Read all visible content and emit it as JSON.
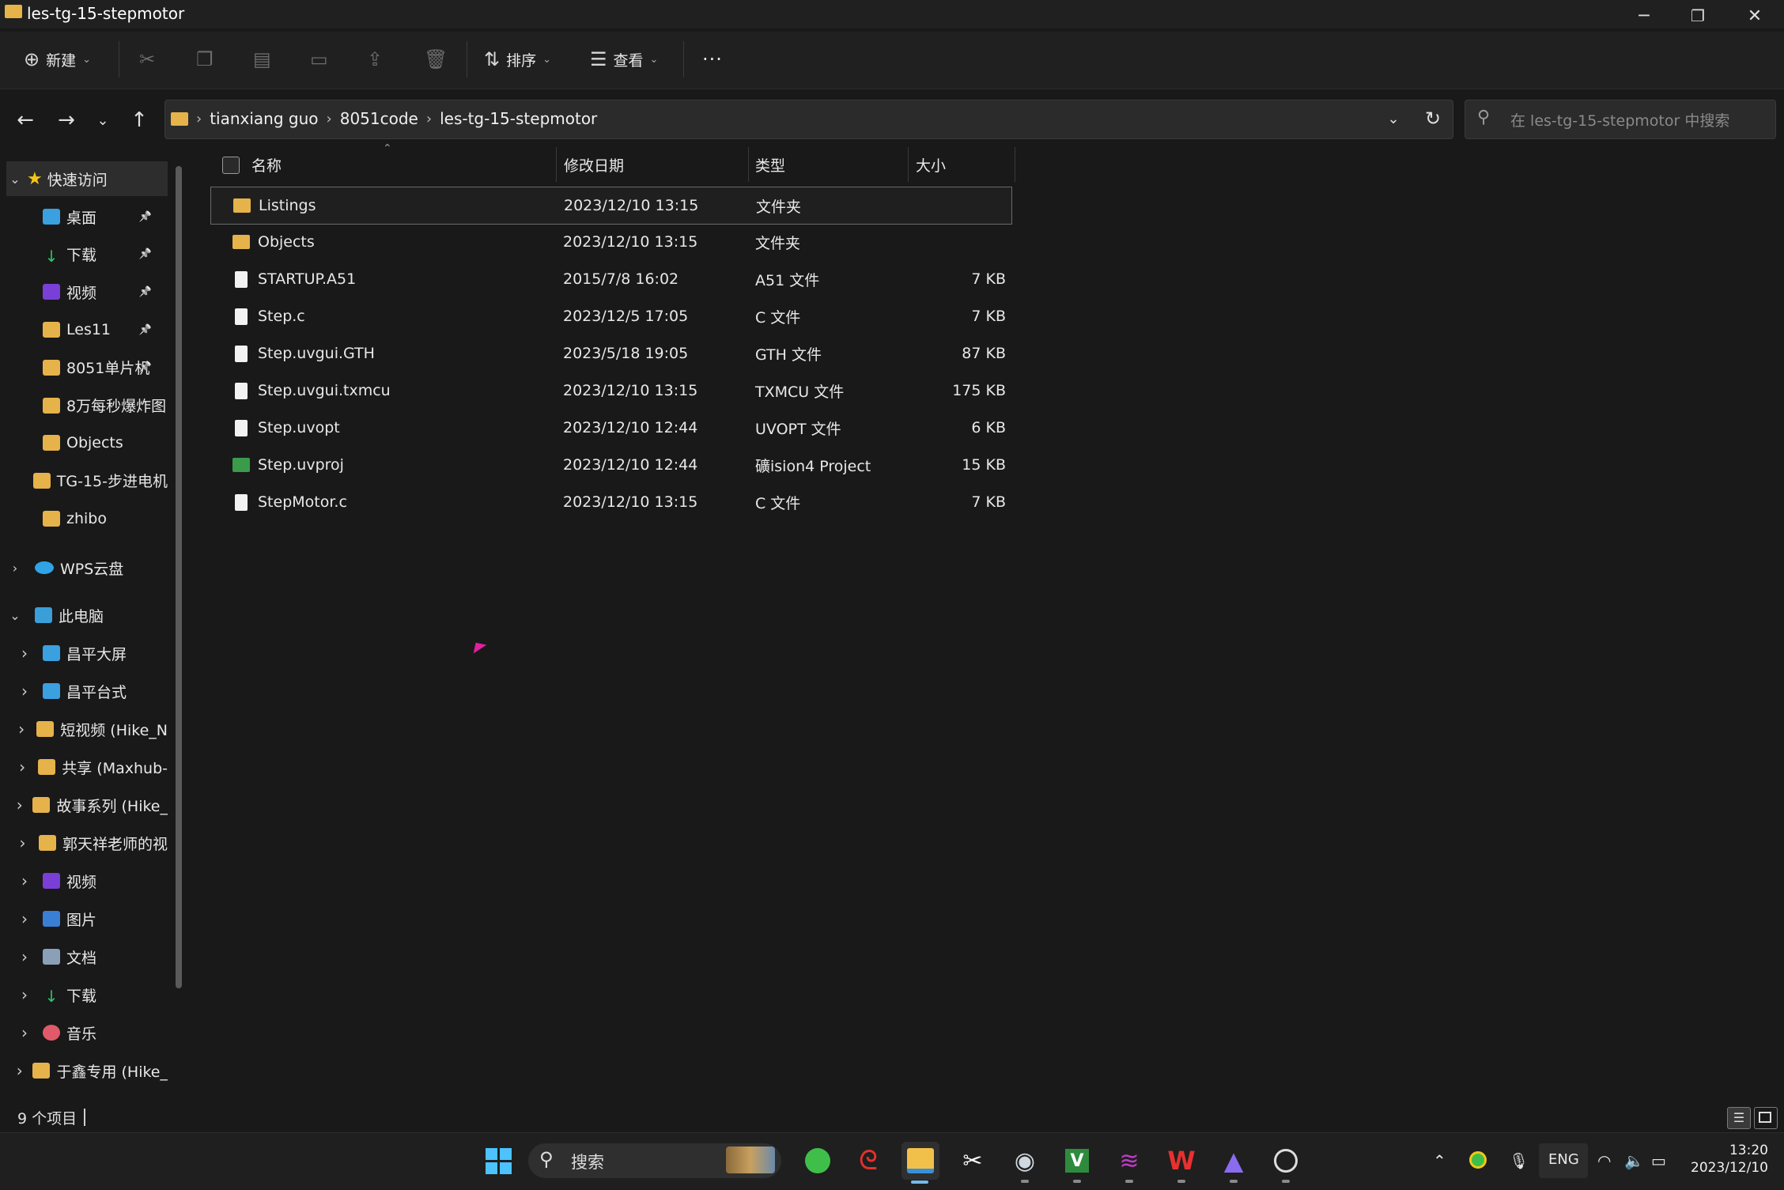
{
  "window": {
    "title": "les-tg-15-stepmotor",
    "controls": [
      "minimize-icon",
      "restore-icon",
      "close-icon"
    ]
  },
  "toolbar": {
    "new_label": "新建",
    "sort_label": "排序",
    "view_label": "查看",
    "more_label": "···"
  },
  "navigation": {
    "breadcrumb": [
      "tianxiang guo",
      "8051code",
      "les-tg-15-stepmotor"
    ],
    "search_placeholder": "在 les-tg-15-stepmotor 中搜索"
  },
  "sidebar": {
    "quick_access": {
      "label": "快速访问",
      "items": [
        {
          "label": "桌面",
          "pinned": true,
          "icon": "desktop-icon"
        },
        {
          "label": "下载",
          "pinned": true,
          "icon": "download-icon"
        },
        {
          "label": "视频",
          "pinned": true,
          "icon": "video-icon"
        },
        {
          "label": "Les11",
          "pinned": true,
          "icon": "folder-icon"
        },
        {
          "label": "8051单片机",
          "pinned": true,
          "icon": "folder-icon"
        },
        {
          "label": "8万每秒爆炸图",
          "pinned": false,
          "icon": "folder-icon"
        },
        {
          "label": "Objects",
          "pinned": false,
          "icon": "folder-icon"
        },
        {
          "label": "TG-15-步进电机",
          "pinned": false,
          "icon": "folder-icon"
        },
        {
          "label": "zhibo",
          "pinned": false,
          "icon": "folder-icon"
        }
      ]
    },
    "wps": {
      "label": "WPS云盘"
    },
    "this_pc": {
      "label": "此电脑",
      "items": [
        {
          "label": "昌平大屏",
          "icon": "monitor-icon"
        },
        {
          "label": "昌平台式",
          "icon": "monitor-icon"
        },
        {
          "label": "短视频 (Hike_N",
          "icon": "folder-icon"
        },
        {
          "label": "共享 (Maxhub-",
          "icon": "folder-icon"
        },
        {
          "label": "故事系列 (Hike_",
          "icon": "folder-icon"
        },
        {
          "label": "郭天祥老师的视",
          "icon": "folder-icon"
        },
        {
          "label": "视频",
          "icon": "video-icon"
        },
        {
          "label": "图片",
          "icon": "pictures-icon"
        },
        {
          "label": "文档",
          "icon": "documents-icon"
        },
        {
          "label": "下载",
          "icon": "download-icon"
        },
        {
          "label": "音乐",
          "icon": "music-icon"
        },
        {
          "label": "于鑫专用 (Hike_",
          "icon": "folder-icon"
        }
      ]
    }
  },
  "file_list": {
    "columns": {
      "name": "名称",
      "modified": "修改日期",
      "type": "类型",
      "size": "大小"
    },
    "rows": [
      {
        "name": "Listings",
        "modified": "2023/12/10 13:15",
        "type": "文件夹",
        "size": "",
        "kind": "folder",
        "selected": true
      },
      {
        "name": "Objects",
        "modified": "2023/12/10 13:15",
        "type": "文件夹",
        "size": "",
        "kind": "folder"
      },
      {
        "name": "STARTUP.A51",
        "modified": "2015/7/8 16:02",
        "type": "A51 文件",
        "size": "7 KB",
        "kind": "file"
      },
      {
        "name": "Step.c",
        "modified": "2023/12/5 17:05",
        "type": "C 文件",
        "size": "7 KB",
        "kind": "file"
      },
      {
        "name": "Step.uvgui.GTH",
        "modified": "2023/5/18 19:05",
        "type": "GTH 文件",
        "size": "87 KB",
        "kind": "file"
      },
      {
        "name": "Step.uvgui.txmcu",
        "modified": "2023/12/10 13:15",
        "type": "TXMCU 文件",
        "size": "175 KB",
        "kind": "file"
      },
      {
        "name": "Step.uvopt",
        "modified": "2023/12/10 12:44",
        "type": "UVOPT 文件",
        "size": "6 KB",
        "kind": "file"
      },
      {
        "name": "Step.uvproj",
        "modified": "2023/12/10 12:44",
        "type": "礦ision4 Project",
        "size": "15 KB",
        "kind": "project"
      },
      {
        "name": "StepMotor.c",
        "modified": "2023/12/10 13:15",
        "type": "C 文件",
        "size": "7 KB",
        "kind": "file"
      }
    ]
  },
  "status": {
    "item_count": "9 个项目"
  },
  "taskbar": {
    "search_label": "搜索",
    "lang": "ENG",
    "time": "13:20",
    "date": "2023/12/10"
  }
}
